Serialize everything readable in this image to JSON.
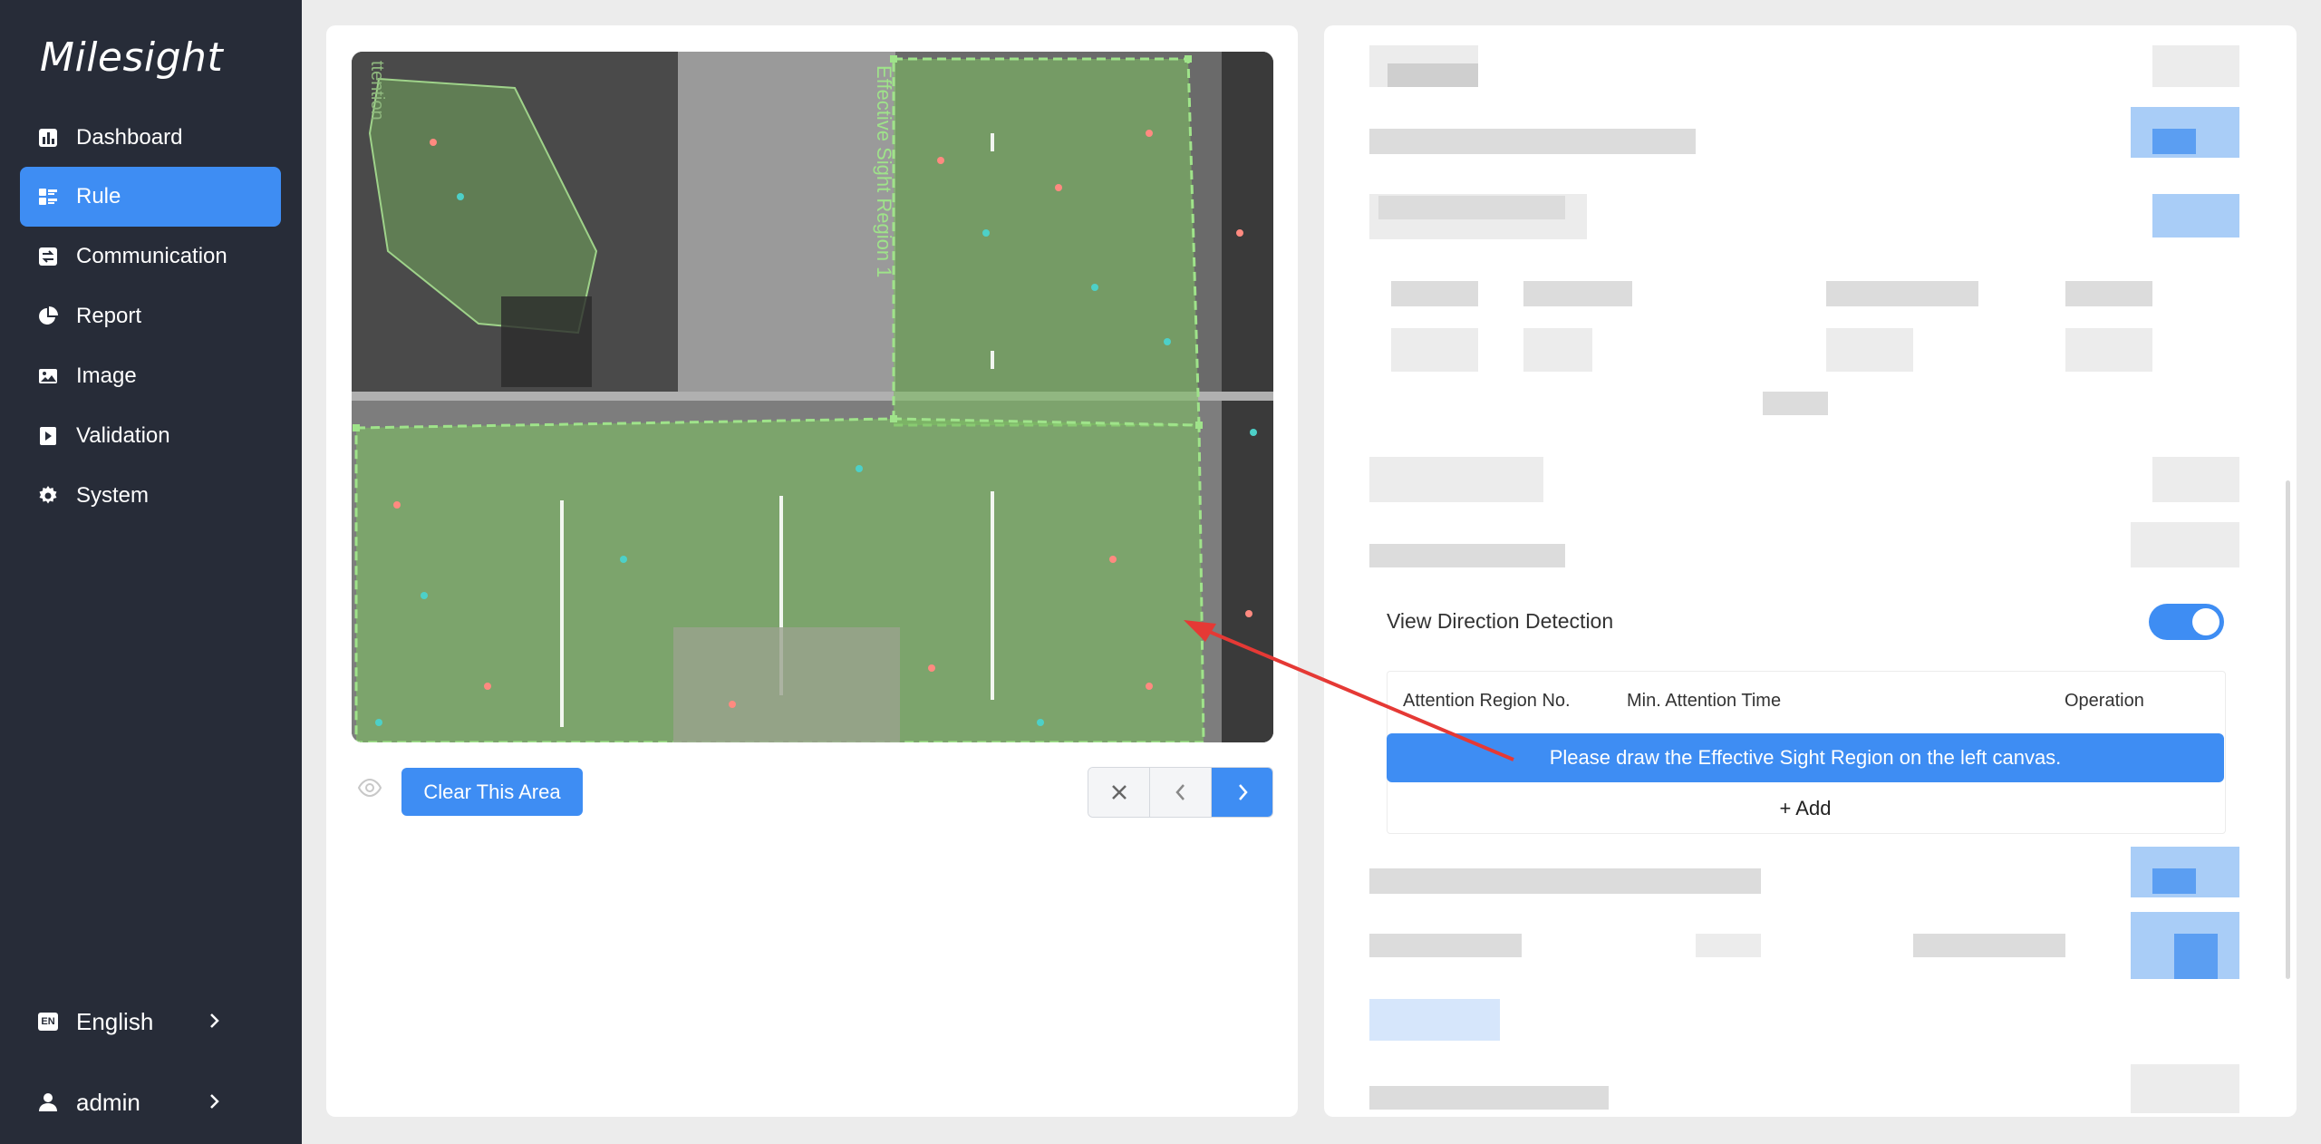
{
  "brand": {
    "logo_text": "Milesight"
  },
  "sidebar": {
    "items": [
      {
        "label": "Dashboard",
        "icon": "bar-chart-icon"
      },
      {
        "label": "Rule",
        "icon": "rule-icon"
      },
      {
        "label": "Communication",
        "icon": "exchange-icon"
      },
      {
        "label": "Report",
        "icon": "pie-chart-icon"
      },
      {
        "label": "Image",
        "icon": "image-icon"
      },
      {
        "label": "Validation",
        "icon": "validation-icon"
      },
      {
        "label": "System",
        "icon": "gear-icon"
      }
    ],
    "active_item": "Rule",
    "language": {
      "label": "English",
      "badge": "EN"
    },
    "user": {
      "label": "admin"
    }
  },
  "canvas": {
    "region_labels": [
      "Effective Sight Region 1",
      "ttention"
    ]
  },
  "controls": {
    "clear_label": "Clear This Area",
    "close_icon": "close-icon",
    "prev_icon": "chevron-left-icon",
    "next_icon": "chevron-right-icon",
    "visibility_icon": "eye-icon"
  },
  "settings": {
    "view_direction_label": "View Direction Detection",
    "view_direction_enabled": true,
    "table": {
      "headers": [
        "Attention Region No.",
        "Min. Attention Time",
        "Operation"
      ],
      "info_message": "Please draw the Effective Sight Region on the left canvas.",
      "add_label": "+ Add"
    }
  },
  "colors": {
    "sidebar_bg": "#272c38",
    "accent": "#3e8df3",
    "region_fill": "#7dbd62",
    "annotation_arrow": "#e53935"
  }
}
